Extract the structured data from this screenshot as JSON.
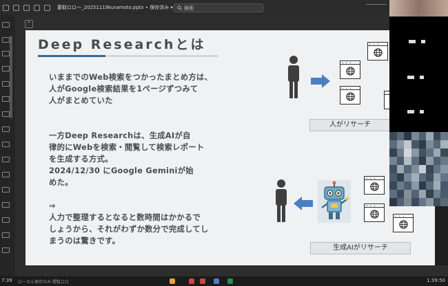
{
  "window": {
    "file_name": "要取ロロ～_20251119kuramoto.pptx • 保存済み ▾",
    "search_placeholder": "検索"
  },
  "slide": {
    "title": "Deep Researchとは",
    "body": {
      "para1": [
        "いままでのWeb検索をつかったまとめ方は、",
        "人がGoogle検索結果を1ページずつみて",
        "人がまとめていた"
      ],
      "para2": [
        "一方Deep Researchは、生成AIが自",
        "律的にWebを検索・閲覧して検索レポート",
        "を生成する方式。",
        "2024/12/30 にGoogle Geminiが始",
        "めた。"
      ],
      "para3": [
        "⇒",
        "人力で整理するとなると数時間はかかるで",
        "しょうから、それがわずか数分で完成してし",
        "まうのは驚きです。"
      ]
    },
    "captions": {
      "human": "人がリサーチ",
      "ai": "生成AIがリサーチ"
    }
  },
  "taskbar": {
    "time_left": "7:39",
    "status": "ローカル保存のみ  閲覧ロロ",
    "time_right": "1:39:50"
  },
  "colors": {
    "accent": "#2f6aa0",
    "arrow": "#4a7fc1",
    "person": "#3f3f3f"
  },
  "icons": [
    "search-icon",
    "person-icon",
    "arrow-right-icon",
    "arrow-left-icon",
    "browser-globe-icon",
    "robot-icon"
  ]
}
